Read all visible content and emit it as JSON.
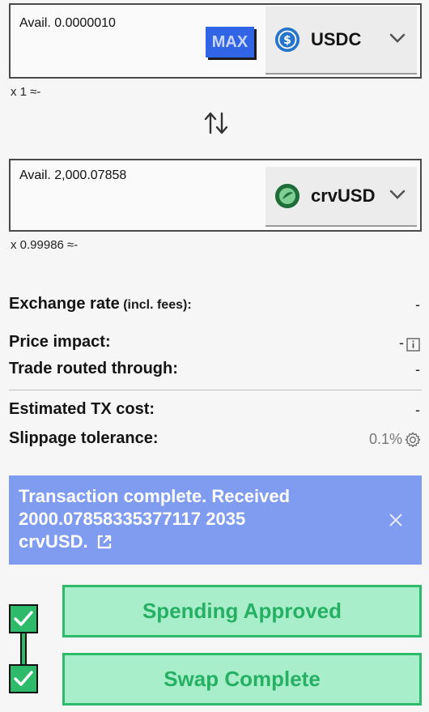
{
  "from": {
    "avail_text": "Avail. 0.0000010",
    "max_label": "MAX",
    "token": "USDC",
    "rate_text": "x 1 ≈-"
  },
  "to": {
    "avail_text": "Avail. 2,000.07858",
    "token": "crvUSD",
    "rate_text": "x 0.99986 ≈-"
  },
  "details": {
    "exchange_rate_label": "Exchange rate",
    "exchange_rate_suffix": "(incl. fees):",
    "exchange_rate_value": "-",
    "price_impact_label": "Price impact:",
    "price_impact_value": "-",
    "route_label": "Trade routed through:",
    "route_value": "-",
    "tx_cost_label": "Estimated TX cost:",
    "tx_cost_value": "-",
    "slippage_label": "Slippage tolerance:",
    "slippage_value": "0.1%"
  },
  "banner": {
    "line1": "Transaction complete. Received",
    "line2": "2000.07858335377117 2035",
    "line3": "crvUSD."
  },
  "steps": [
    {
      "label": "Spending Approved"
    },
    {
      "label": "Swap Complete"
    }
  ],
  "colors": {
    "max_bg": "#3264e6",
    "usdc": "#2775ca",
    "crvusd": "#2a8a4a",
    "banner_bg": "#7f9cf0",
    "step_bg": "#a9eecb",
    "step_accent": "#2dbb6b"
  },
  "icons": {
    "swap": "swap-arrows-icon",
    "usdc": "usdc-coin-icon",
    "crvusd": "crvusd-coin-icon",
    "chevron": "chevron-down-icon",
    "info": "info-icon",
    "gear": "gear-icon",
    "close": "close-icon",
    "external": "external-link-icon",
    "check": "check-icon"
  }
}
